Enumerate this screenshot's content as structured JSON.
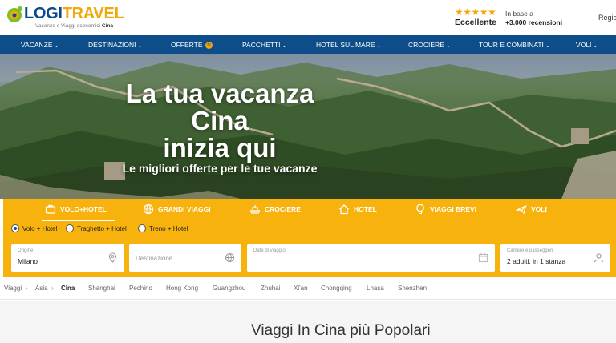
{
  "header": {
    "logo_part1": "LOGI",
    "logo_part2": "TRAVEL",
    "tagline": "Vacanze e Viaggi economici",
    "tagline_bold": "Cina",
    "rating_stars": "★★★★★",
    "rating_label": "Eccellente",
    "rating_note_line1": "In base a",
    "rating_note_line2": "+3.000 recensioni",
    "register": "Regis"
  },
  "nav": {
    "items": [
      {
        "label": "VACANZE"
      },
      {
        "label": "DESTINAZIONI"
      },
      {
        "label": "OFFERTE"
      },
      {
        "label": "PACCHETTI"
      },
      {
        "label": "HOTEL SUL MARE"
      },
      {
        "label": "CROCIERE"
      },
      {
        "label": "TOUR E COMBINATI"
      },
      {
        "label": "VOLI"
      }
    ],
    "offers_badge": "%"
  },
  "hero": {
    "line1": "La tua vacanza",
    "line2": "Cina",
    "line3": "inizia qui",
    "subtitle": "Le migliori offerte per le tue vacanze"
  },
  "search": {
    "tabs": [
      {
        "label": "VOLO+HOTEL",
        "icon": "suitcase-icon"
      },
      {
        "label": "GRANDI VIAGGI",
        "icon": "globe-icon"
      },
      {
        "label": "CROCIERE",
        "icon": "ship-icon"
      },
      {
        "label": "HOTEL",
        "icon": "house-icon"
      },
      {
        "label": "VIAGGI BREVI",
        "icon": "balloon-icon"
      },
      {
        "label": "VOLI",
        "icon": "plane-icon"
      }
    ],
    "radios": [
      {
        "label": "Volo + Hotel",
        "selected": true
      },
      {
        "label": "Traghetto + Hotel",
        "selected": false
      },
      {
        "label": "Treno + Hotel",
        "selected": false
      }
    ],
    "origin_label": "Origine",
    "origin_value": "Milano",
    "destination_placeholder": "Destinazione",
    "dates_label": "Date di viaggio",
    "rooms_label": "Camere e passeggeri",
    "rooms_value": "2 adulti, in 1 stanza"
  },
  "breadcrumb": {
    "items": [
      "Viaggi",
      "Asia",
      "Cina"
    ],
    "cities": [
      "Shanghai",
      "Pechino",
      "Hong Kong",
      "Guangzhou",
      "Zhuhai",
      "Xi'an",
      "Chongqing",
      "Lhasa",
      "Shenzhen"
    ]
  },
  "main": {
    "section_title": "Viaggi In Cina più Popolari"
  },
  "colors": {
    "brand_blue": "#0d4d8a",
    "brand_yellow": "#f7b20d"
  }
}
